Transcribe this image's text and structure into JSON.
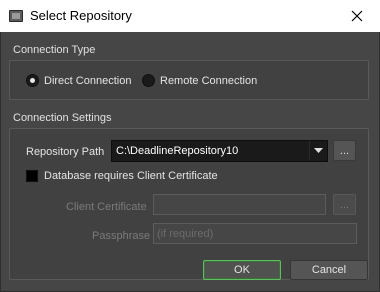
{
  "window": {
    "title": "Select Repository"
  },
  "connection_type": {
    "label": "Connection Type",
    "options": [
      {
        "label": "Direct Connection",
        "checked": true
      },
      {
        "label": "Remote Connection",
        "checked": false
      }
    ]
  },
  "connection_settings": {
    "label": "Connection Settings",
    "repository_path": {
      "label": "Repository Path",
      "value": "C:\\DeadlineRepository10",
      "browse_label": "..."
    },
    "client_cert_checkbox": {
      "label": "Database requires Client Certificate",
      "checked": false
    },
    "client_certificate": {
      "label": "Client Certificate",
      "value": "",
      "browse_label": "..."
    },
    "passphrase": {
      "label": "Passphrase",
      "placeholder": "(if required)"
    }
  },
  "buttons": {
    "ok": "OK",
    "cancel": "Cancel"
  },
  "colors": {
    "ok_focus_border": "#5fbf5f",
    "background": "#464646"
  },
  "icons": {
    "app": "app-icon",
    "close": "close-icon",
    "dropdown": "chevron-down-icon"
  }
}
